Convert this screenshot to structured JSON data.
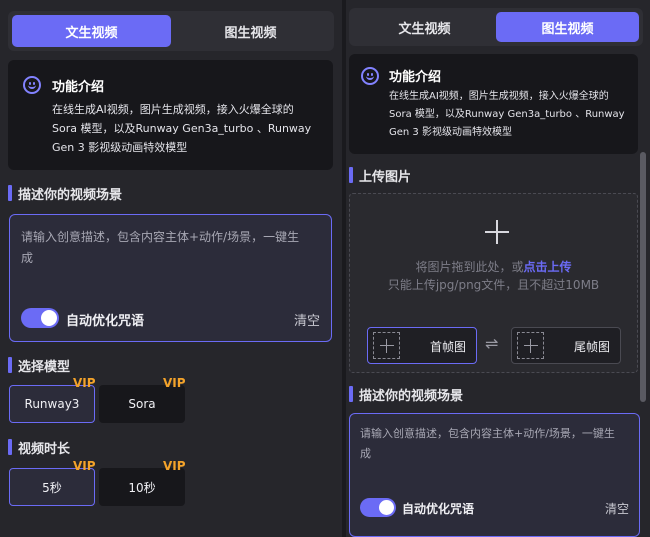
{
  "left": {
    "tabs": [
      {
        "label": "文生视频",
        "active": true
      },
      {
        "label": "图生视频",
        "active": false
      }
    ],
    "intro": {
      "title": "功能介绍",
      "lines": [
        "在线生成AI视频，图片生成视频，接入火爆全球的",
        "Sora 模型，以及Runway Gen3a_turbo 、Runway",
        "Gen 3 影视级动画特效模型"
      ]
    },
    "prompt": {
      "section_title": "描述你的视频场景",
      "placeholder_lines": [
        "请输入创意描述，包含内容主体+动作/场景，一键生",
        "成"
      ],
      "toggle_label": "自动优化咒语",
      "toggle_on": true,
      "clear_label": "清空"
    },
    "model": {
      "section_title": "选择模型",
      "options": [
        {
          "label": "Runway3",
          "vip": "VIP",
          "selected": true
        },
        {
          "label": "Sora",
          "vip": "VIP",
          "selected": false
        }
      ]
    },
    "duration": {
      "section_title": "视频时长",
      "options": [
        {
          "label": "5秒",
          "vip": "VIP",
          "selected": true
        },
        {
          "label": "10秒",
          "vip": "VIP",
          "selected": false
        }
      ]
    }
  },
  "right": {
    "tabs": [
      {
        "label": "文生视频",
        "active": false
      },
      {
        "label": "图生视频",
        "active": true
      }
    ],
    "intro": {
      "title": "功能介绍",
      "lines": [
        "在线生成AI视频，图片生成视频，接入火爆全球的",
        "Sora 模型，以及Runway Gen3a_turbo 、Runway",
        "Gen 3 影视级动画特效模型"
      ]
    },
    "upload": {
      "section_title": "上传图片",
      "hint_prefix": "将图片拖到此处，或",
      "hint_link": "点击上传",
      "limit": "只能上传jpg/png文件，且不超过10MB",
      "first_frame": "首帧图",
      "last_frame": "尾帧图",
      "swap_symbol": "⇌"
    },
    "prompt": {
      "section_title": "描述你的视频场景",
      "placeholder_lines": [
        "请输入创意描述，包含内容主体+动作/场景，一键生",
        "成"
      ],
      "toggle_label": "自动优化咒语",
      "toggle_on": true,
      "clear_label": "清空"
    }
  },
  "colors": {
    "accent": "#6b6bf5",
    "vip": "#f4a32a",
    "background": "#26262b",
    "card": "#17171b"
  }
}
